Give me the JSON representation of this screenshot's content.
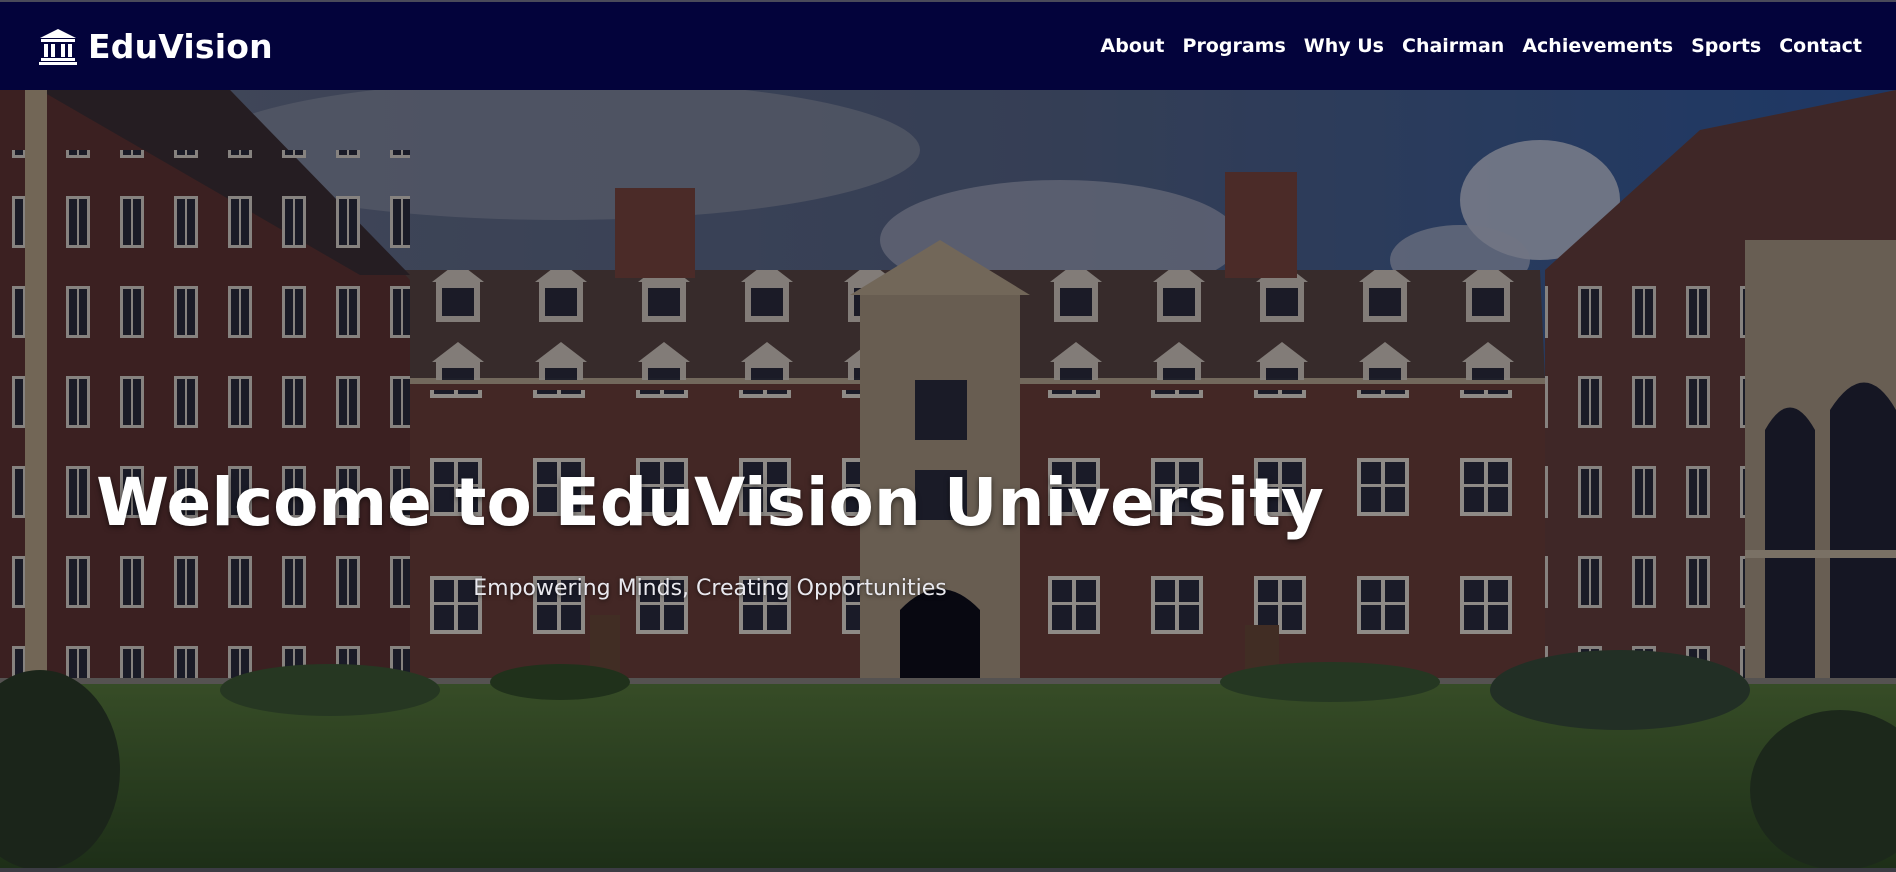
{
  "brand": {
    "name": "EduVision",
    "icon": "university-building-icon"
  },
  "nav": {
    "links": [
      {
        "label": "About"
      },
      {
        "label": "Programs"
      },
      {
        "label": "Why Us"
      },
      {
        "label": "Chairman"
      },
      {
        "label": "Achievements"
      },
      {
        "label": "Sports"
      },
      {
        "label": "Contact"
      }
    ]
  },
  "hero": {
    "title": "Welcome to EduVision University",
    "subtitle": "Empowering Minds, Creating Opportunities",
    "background": "university-courtyard-photo"
  },
  "colors": {
    "navbar": "#03033b",
    "text": "#ffffff",
    "brick": "#6b3b2c",
    "stone": "#b8a57f",
    "lawn": "#4f7a2b",
    "sky": "#3d6aa8"
  }
}
